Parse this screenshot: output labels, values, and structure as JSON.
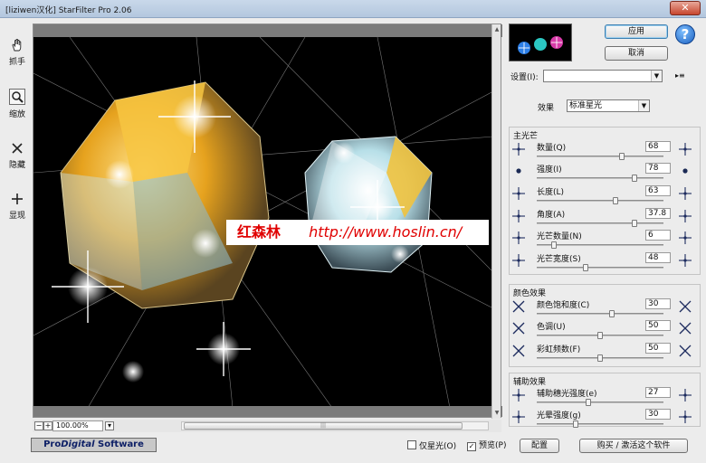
{
  "window": {
    "title": "[liziwen汉化] StarFilter Pro 2.06",
    "close_glyph": "✕"
  },
  "tools": [
    {
      "name": "hand",
      "label": "抓手",
      "icon": "hand-icon"
    },
    {
      "name": "zoom",
      "label": "缩放",
      "icon": "magnifier-icon"
    },
    {
      "name": "hide",
      "label": "隐藏",
      "icon": "cross-icon"
    },
    {
      "name": "show",
      "label": "显现",
      "icon": "plus-icon"
    }
  ],
  "preview": {
    "watermark_name": "红森林",
    "watermark_url": "http://www.hoslin.cn/",
    "zoom_minus": "−",
    "zoom_plus": "+",
    "zoom_value": "100.00%"
  },
  "buttons": {
    "apply": "应用",
    "cancel": "取消",
    "config": "配置",
    "buy": "购买 / 激活这个软件",
    "help": "?"
  },
  "settings": {
    "label": "设置(I):",
    "value": ""
  },
  "effect": {
    "label": "效果",
    "value": "标准星光"
  },
  "groups": {
    "main": {
      "title": "主光芒",
      "params": [
        {
          "label": "数量(Q)",
          "value": "68",
          "fraction": 0.68
        },
        {
          "label": "强度(I)",
          "value": "78",
          "fraction": 0.78
        },
        {
          "label": "长度(L)",
          "value": "63",
          "fraction": 0.63
        },
        {
          "label": "角度(A)",
          "value": "37.8",
          "fraction": 0.78
        },
        {
          "label": "光芒数量(N)",
          "value": "6",
          "fraction": 0.12
        },
        {
          "label": "光芒宽度(S)",
          "value": "48",
          "fraction": 0.38
        }
      ]
    },
    "color": {
      "title": "颜色效果",
      "params": [
        {
          "label": "颜色饱和度(C)",
          "value": "30",
          "fraction": 0.6
        },
        {
          "label": "色调(U)",
          "value": "50",
          "fraction": 0.5
        },
        {
          "label": "彩虹频数(F)",
          "value": "50",
          "fraction": 0.5
        }
      ]
    },
    "aux": {
      "title": "辅助效果",
      "params": [
        {
          "label": "辅助穗光强度(e)",
          "value": "27",
          "fraction": 0.4
        },
        {
          "label": "光晕强度(g)",
          "value": "30",
          "fraction": 0.3
        }
      ]
    }
  },
  "footer": {
    "logo_pro": "Pro",
    "logo_digital": "Digital",
    "logo_software": " Software",
    "only_star_label": "仅星光(O)",
    "only_star_checked": false,
    "preview_label": "预览(P)",
    "preview_checked": true,
    "check_glyph": "✓"
  },
  "colors": {
    "accent": "#1a5fbf",
    "watermark": "#e00000",
    "gold": "#f2b632",
    "diamond": "#bfe7ef"
  }
}
